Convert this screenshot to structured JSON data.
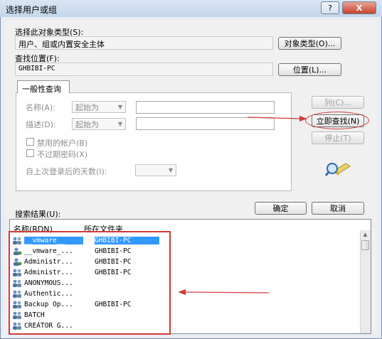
{
  "window": {
    "title": "选择用户或组",
    "help_label": "?",
    "close_label": "X"
  },
  "object_type": {
    "label": "选择此对象类型(S):",
    "value": "用户、组或内置安全主体",
    "button": "对象类型(O)..."
  },
  "location": {
    "label": "查找位置(F):",
    "value": "GHBIBI-PC",
    "button": "位置(L)..."
  },
  "query_tab": {
    "label": "一般性查询"
  },
  "query": {
    "name_label": "名称(A):",
    "name_mode": "起始为",
    "desc_label": "描述(D):",
    "desc_mode": "起始为",
    "disabled_accounts": "禁用的帐户(B)",
    "non_expiring_pwd": "不过期密码(X)",
    "days_label": "自上次登录后的天数(I):"
  },
  "side_buttons": {
    "columns": "列(C)...",
    "find_now": "立即查找(N)",
    "stop": "停止(T)"
  },
  "results": {
    "label": "搜索结果(U):",
    "ok": "确定",
    "cancel": "取消",
    "columns": [
      "名称(RDN)",
      "所在文件夹"
    ],
    "rows": [
      {
        "name": "__vmware__",
        "folder": "GHBIBI-PC",
        "icon": "group-icon",
        "selected": true
      },
      {
        "name": "__vmware_...",
        "folder": "GHBIBI-PC",
        "icon": "user-icon",
        "selected": false
      },
      {
        "name": "Administr...",
        "folder": "GHBIBI-PC",
        "icon": "user-icon",
        "selected": false
      },
      {
        "name": "Administr...",
        "folder": "GHBIBI-PC",
        "icon": "group-icon",
        "selected": false
      },
      {
        "name": "ANONYMOUS...",
        "folder": "",
        "icon": "group-icon",
        "selected": false
      },
      {
        "name": "Authentic...",
        "folder": "",
        "icon": "group-icon",
        "selected": false
      },
      {
        "name": "Backup Op...",
        "folder": "GHBIBI-PC",
        "icon": "group-icon",
        "selected": false
      },
      {
        "name": "BATCH",
        "folder": "",
        "icon": "group-icon",
        "selected": false
      },
      {
        "name": "CREATOR G...",
        "folder": "",
        "icon": "group-icon",
        "selected": false
      }
    ]
  },
  "colors": {
    "annotation": "#d23a3a",
    "selection": "#3399ff"
  }
}
